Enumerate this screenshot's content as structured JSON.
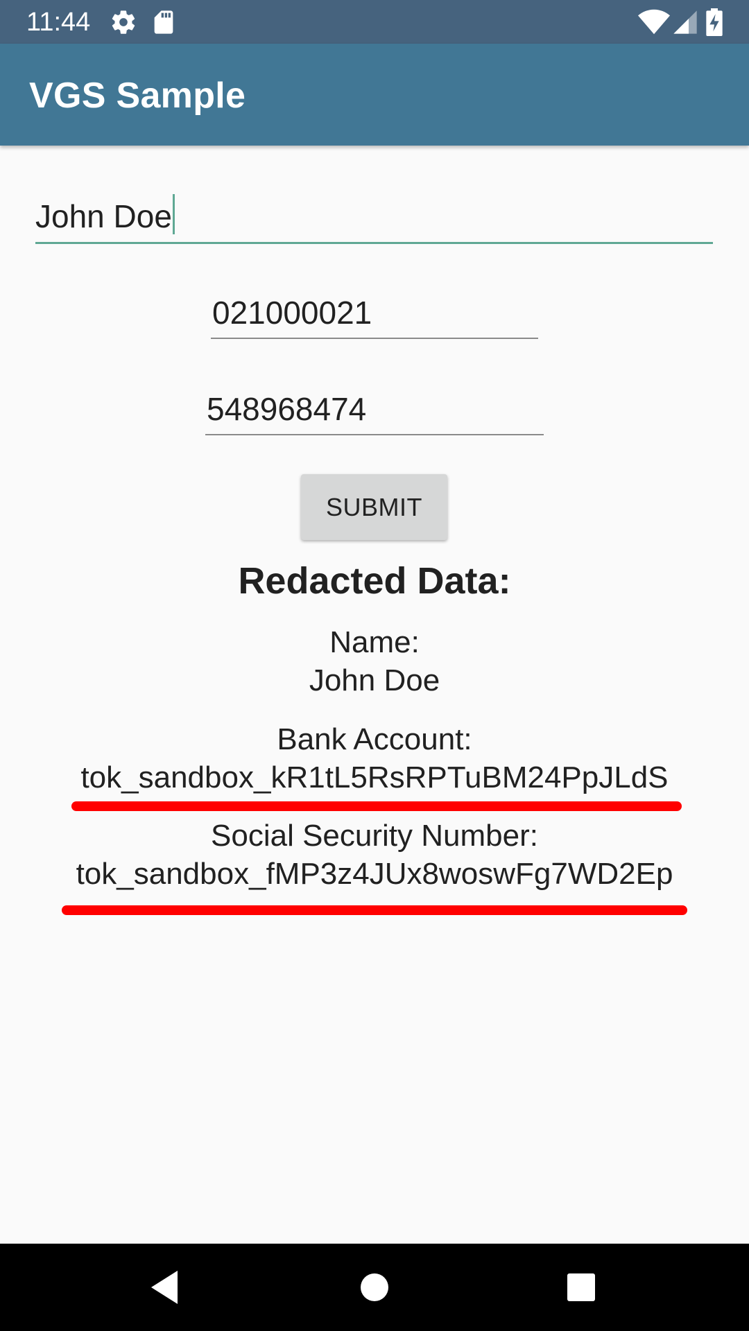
{
  "status_bar": {
    "time": "11:44",
    "icons": [
      "gear-icon",
      "sd-card-icon",
      "wifi-icon",
      "signal-icon",
      "battery-charging-icon"
    ]
  },
  "app_bar": {
    "title": "VGS Sample",
    "color": "#417795"
  },
  "form": {
    "name_value": "John Doe",
    "routing_value": "021000021",
    "account_value": "548968474",
    "submit_label": "SUBMIT"
  },
  "results": {
    "title": "Redacted Data:",
    "name_label": "Name:",
    "name_value": "John Doe",
    "bank_label": "Bank Account:",
    "bank_value": "tok_sandbox_kR1tL5RsRPTuBM24PpJLdS",
    "ssn_label": "Social Security Number:",
    "ssn_value": "tok_sandbox_fMP3z4JUx8woswFg7WD2Ep"
  },
  "annotation_color": "#ff0000",
  "nav_bar": {
    "icons": [
      "back-icon",
      "home-icon",
      "recents-icon"
    ]
  }
}
